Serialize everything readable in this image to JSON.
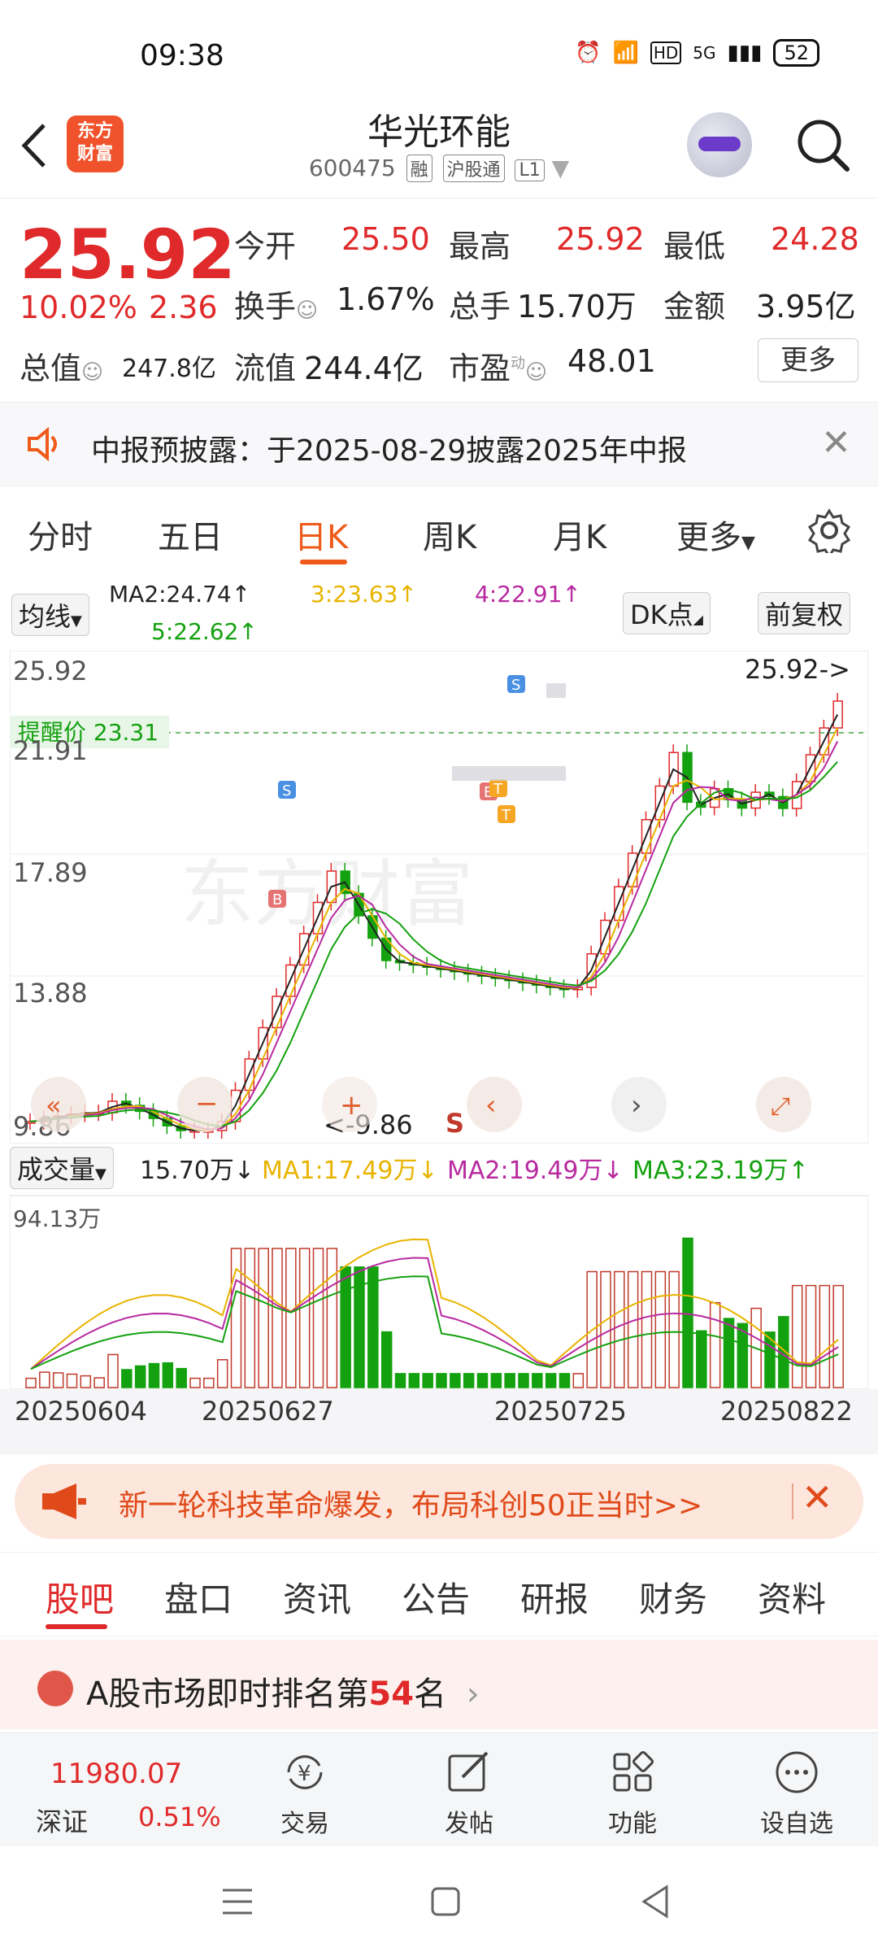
{
  "status": {
    "time": "09:38",
    "network": "5G",
    "battery": "52"
  },
  "header": {
    "logo": "东方财富",
    "title": "华光环能",
    "code": "600475",
    "tags": [
      "融",
      "沪股通",
      "L1"
    ]
  },
  "quote": {
    "price": "25.92",
    "change_pct": "10.02%",
    "change": "2.36",
    "open_label": "今开",
    "open": "25.50",
    "high_label": "最高",
    "high": "25.92",
    "low_label": "最低",
    "low": "24.28",
    "turnover_label": "换手",
    "turnover": "1.67%",
    "volume_label": "总手",
    "volume": "15.70万",
    "amount_label": "金额",
    "amount": "3.95亿",
    "mcap_label": "总值",
    "mcap": "247.8亿",
    "float_label": "流值",
    "float": "244.4亿",
    "pe_label": "市盈",
    "pe_sup": "动",
    "pe": "48.01",
    "more_label": "更多"
  },
  "notice": {
    "text": "中报预披露：于2025-08-29披露2025年中报"
  },
  "ktabs": [
    "分时",
    "五日",
    "日K",
    "周K",
    "月K",
    "更多"
  ],
  "ma_legend": {
    "mode": "均线",
    "ma2": "MA2:24.74",
    "ma3": "3:23.63",
    "ma4": "4:22.91",
    "ma5": "5:22.62",
    "dk": "DK点",
    "adjust": "前复权"
  },
  "chart_data": {
    "type": "candlestick",
    "y_ticks": [
      "25.92",
      "21.91",
      "17.89",
      "13.88",
      "9.86"
    ],
    "alert_label": "提醒价 23.31",
    "last_price_label": "25.92->",
    "low_label": "<-9.86",
    "s_marker": "S",
    "markers": [
      "S",
      "B",
      "S",
      "B",
      "T",
      "T"
    ],
    "x_dates": [
      "20250604",
      "20250627",
      "20250725",
      "20250822"
    ],
    "ylim": [
      9.86,
      25.92
    ]
  },
  "volume": {
    "mode": "成交量",
    "current": "15.70万",
    "ma1": "MA1:17.49万",
    "ma2": "MA2:19.49万",
    "ma3": "MA3:23.19万",
    "max_label": "94.13万"
  },
  "ad": {
    "text": "新一轮科技革命爆发，布局科创50正当时>>"
  },
  "btabs": [
    "股吧",
    "盘口",
    "资讯",
    "公告",
    "研报",
    "财务",
    "资料"
  ],
  "rank": {
    "prefix": "A股市场即时排名第",
    "num": "54",
    "suffix": "名"
  },
  "toolbar": {
    "index_value": "11980.07",
    "index_name": "深证",
    "index_pct": "0.51%",
    "trade": "交易",
    "post": "发帖",
    "func": "功能",
    "watch": "设自选"
  },
  "colors": {
    "up": "#e0292a",
    "down": "#14a10f",
    "accent": "#ef5a1a"
  }
}
